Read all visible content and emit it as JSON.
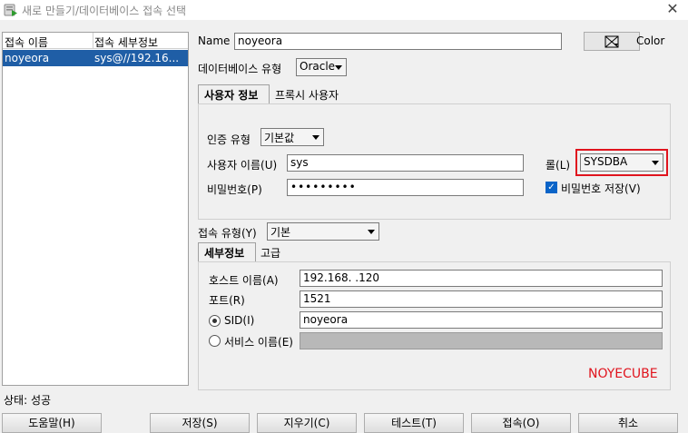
{
  "window": {
    "title": "새로 만들기/데이터베이스 접속 선택"
  },
  "list": {
    "headers": [
      "접속 이름",
      "접속 세부정보"
    ],
    "rows": [
      {
        "name": "noyeora",
        "details": "sys@//192.16..."
      }
    ]
  },
  "form": {
    "name_label": "Name",
    "name_value": "noyeora",
    "color_label": "Color",
    "dbtype_label": "데이터베이스 유형",
    "dbtype_value": "Oracle",
    "tabs": [
      "사용자 정보",
      "프록시 사용자"
    ],
    "auth_label": "인증 유형",
    "auth_value": "기본값",
    "user_label": "사용자 이름(U)",
    "user_value": "sys",
    "role_label": "롤(L)",
    "role_value": "SYSDBA",
    "pwd_label": "비밀번호(P)",
    "pwd_value": "•••••••••",
    "save_pwd_label": "비밀번호 저장(V)",
    "conn_type_label": "접속 유형(Y)",
    "conn_type_value": "기본",
    "detail_tabs": [
      "세부정보",
      "고급"
    ],
    "host_label": "호스트 이름(A)",
    "host_value": "192.168.   .120",
    "port_label": "포트(R)",
    "port_value": "1521",
    "sid_label": "SID(I)",
    "sid_value": "noyeora",
    "service_label": "서비스 이름(E)",
    "watermark": "NOYECUBE"
  },
  "status": {
    "text": "상태: 성공"
  },
  "buttons": {
    "help": "도움말(H)",
    "save": "저장(S)",
    "clear": "지우기(C)",
    "test": "테스트(T)",
    "connect": "접속(O)",
    "cancel": "취소"
  },
  "colors": {
    "selection": "#1f5ea6",
    "highlight": "#e0141e",
    "checkbox": "#0a64c8"
  },
  "icons": {
    "app": "database-connect-icon",
    "close": "close-icon",
    "color_picker": "color-swatch-icon"
  }
}
